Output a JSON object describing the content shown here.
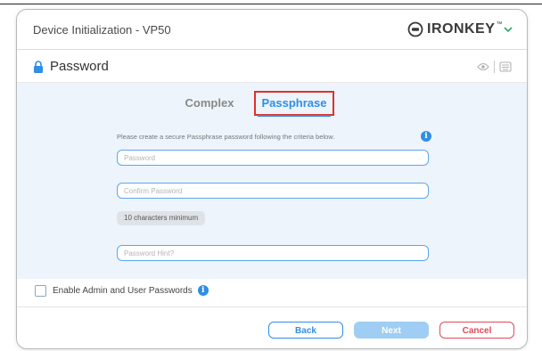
{
  "window": {
    "title": "Device Initialization - VP50"
  },
  "brand": {
    "name": "IRONKEY",
    "tm": "™",
    "color": "#3a3a3a"
  },
  "section": {
    "title": "Password",
    "icon": "lock-icon"
  },
  "tabs": [
    {
      "label": "Complex",
      "active": false
    },
    {
      "label": "Passphrase",
      "active": true
    }
  ],
  "form": {
    "instruction": "Please create a secure Passphrase password following the criteria below.",
    "password": {
      "placeholder": "Password",
      "value": ""
    },
    "confirm": {
      "placeholder": "Confirm Password",
      "value": ""
    },
    "requirement": "10 characters minimum",
    "hint": {
      "placeholder": "Password Hint?",
      "value": ""
    }
  },
  "admin": {
    "label": "Enable Admin and User Passwords",
    "checked": false
  },
  "buttons": {
    "back": "Back",
    "next": "Next",
    "cancel": "Cancel"
  },
  "colors": {
    "accent": "#2f8ee5",
    "panel": "#edf4fc",
    "highlight": "#e0302a",
    "cancel": "#e04a5a",
    "next_disabled": "#9fcdf3"
  }
}
